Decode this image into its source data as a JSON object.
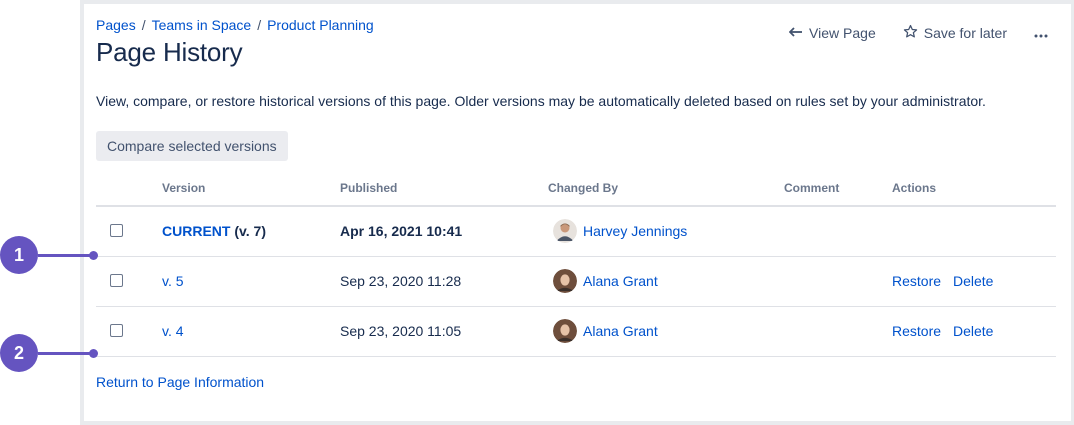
{
  "breadcrumb": [
    {
      "label": "Pages"
    },
    {
      "label": "Teams in Space"
    },
    {
      "label": "Product Planning"
    }
  ],
  "page_title": "Page History",
  "toolbar": {
    "view_page": "View Page",
    "save_for_later": "Save for later",
    "more": "•••"
  },
  "intro": "View, compare, or restore historical versions of this page. Older versions may be automatically deleted based on rules set by your administrator.",
  "compare_button": "Compare selected versions",
  "table": {
    "headers": [
      "Version",
      "Published",
      "Changed By",
      "Comment",
      "Actions"
    ],
    "rows": [
      {
        "version": "CURRENT",
        "version_suffix": " (v. 7)",
        "published": "Apr 16, 2021 10:41",
        "changed_by": "Harvey Jennings",
        "comment": "",
        "restore": "",
        "delete": ""
      },
      {
        "version": "v. 5",
        "version_suffix": "",
        "published": "Sep 23, 2020 11:28",
        "changed_by": "Alana Grant",
        "comment": "",
        "restore": "Restore",
        "delete": "Delete"
      },
      {
        "version": "v. 4",
        "version_suffix": "",
        "published": "Sep 23, 2020 11:05",
        "changed_by": "Alana Grant",
        "comment": "",
        "restore": "Restore",
        "delete": "Delete"
      }
    ]
  },
  "return_link": "Return to Page Information",
  "markers": [
    "1",
    "2"
  ],
  "colors": {
    "link": "#0052cc",
    "text": "#172b4d",
    "subtle": "#6b778c",
    "marker": "#6554c0"
  }
}
